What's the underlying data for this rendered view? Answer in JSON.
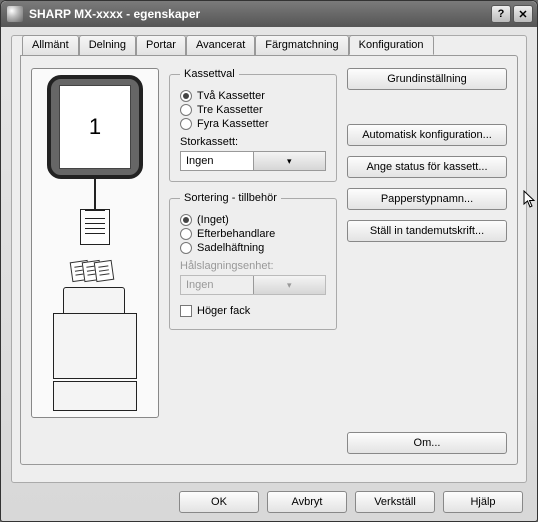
{
  "window": {
    "title": "SHARP MX-xxxx - egenskaper",
    "help_btn": "?",
    "close_btn": "✕"
  },
  "tabs": [
    "Allmänt",
    "Delning",
    "Portar",
    "Avancerat",
    "Färgmatchning",
    "Konfiguration"
  ],
  "active_tab": "Konfiguration",
  "preview": {
    "page_number": "1"
  },
  "kassettval": {
    "legend": "Kassettval",
    "options": [
      "Två Kassetter",
      "Tre Kassetter",
      "Fyra Kassetter"
    ],
    "selected": "Två Kassetter",
    "storkassett_label": "Storkassett:",
    "storkassett_value": "Ingen"
  },
  "sortering": {
    "legend": "Sortering - tillbehör",
    "options": [
      "(Inget)",
      "Efterbehandlare",
      "Sadelhäftning"
    ],
    "selected": "(Inget)",
    "halsning_label": "Hålslagningsenhet:",
    "halsning_value": "Ingen",
    "hoger_fack_label": "Höger fack"
  },
  "right_buttons": {
    "grundinst": "Grundinställning",
    "auto_konfig": "Automatisk konfiguration...",
    "ange_status": "Ange status för kassett...",
    "papperstyp": "Papperstypnamn...",
    "tandem": "Ställ in tandemutskrift..."
  },
  "om_button": "Om...",
  "dialog_buttons": {
    "ok": "OK",
    "avbryt": "Avbryt",
    "verkstall": "Verkställ",
    "hjalp": "Hjälp"
  }
}
